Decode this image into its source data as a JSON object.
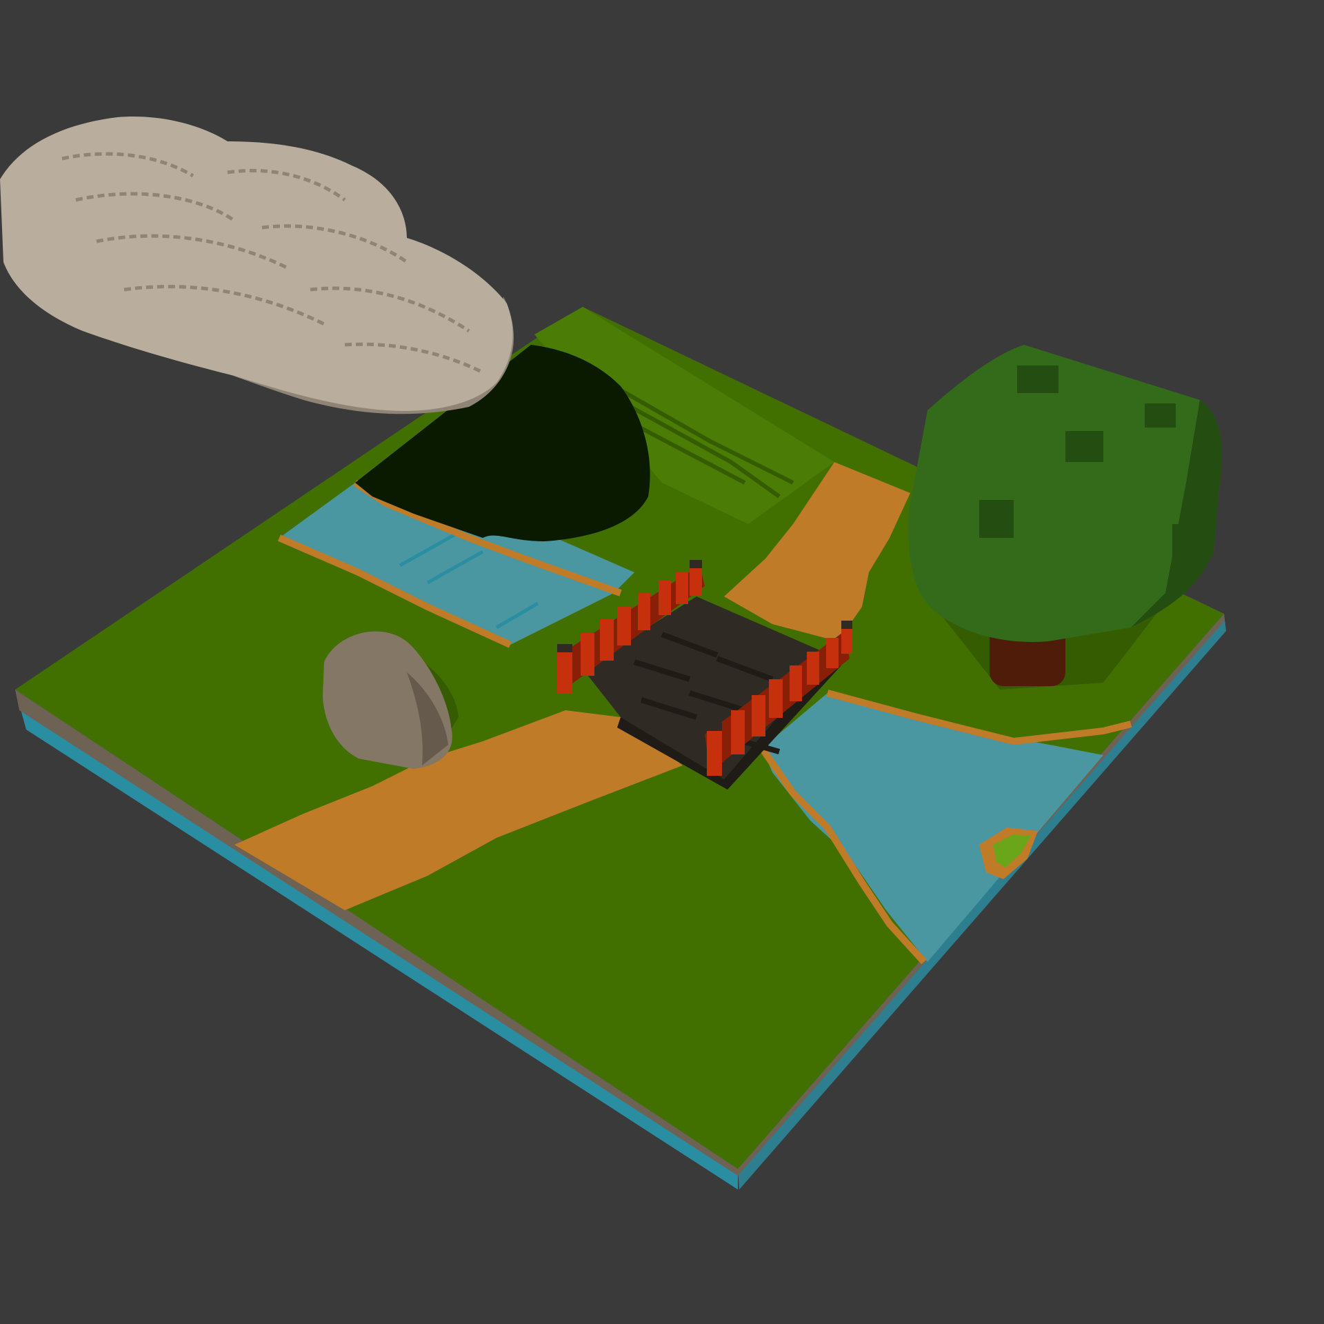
{
  "scene": {
    "background": "#3a3a3a",
    "colors": {
      "grass_top": "#427000",
      "grass_dark": "#365c00",
      "grass_light": "#4a7c06",
      "water": "#4a97a1",
      "water_dark": "#2d7f90",
      "water_edge": "#2a8ea3",
      "dirt": "#c07b28",
      "dirt_dark": "#8a6a3e",
      "soil_edge": "#6e6255",
      "cloud": "#b9ae9d",
      "cloud_shade": "#8f8475",
      "rock": "#857765",
      "rock_dark": "#665a4c",
      "bridge_deck": "#2f2a24",
      "bridge_deck_dark": "#1f1b17",
      "bridge_rail": "#c7300d",
      "bridge_rail_dark": "#8a1f08",
      "tree_canopy": "#336b1b",
      "tree_canopy_light": "#3a7520",
      "tree_canopy_dark": "#244d12",
      "tree_trunk": "#4f1c0a",
      "shadow": "#0a1a00",
      "islet_grass": "#6aa51a"
    },
    "objects": [
      "grass-ground",
      "river",
      "dirt-path",
      "wooden-bridge",
      "red-railing",
      "boulder",
      "tree",
      "cloud",
      "cloud-shadow",
      "islet"
    ]
  }
}
